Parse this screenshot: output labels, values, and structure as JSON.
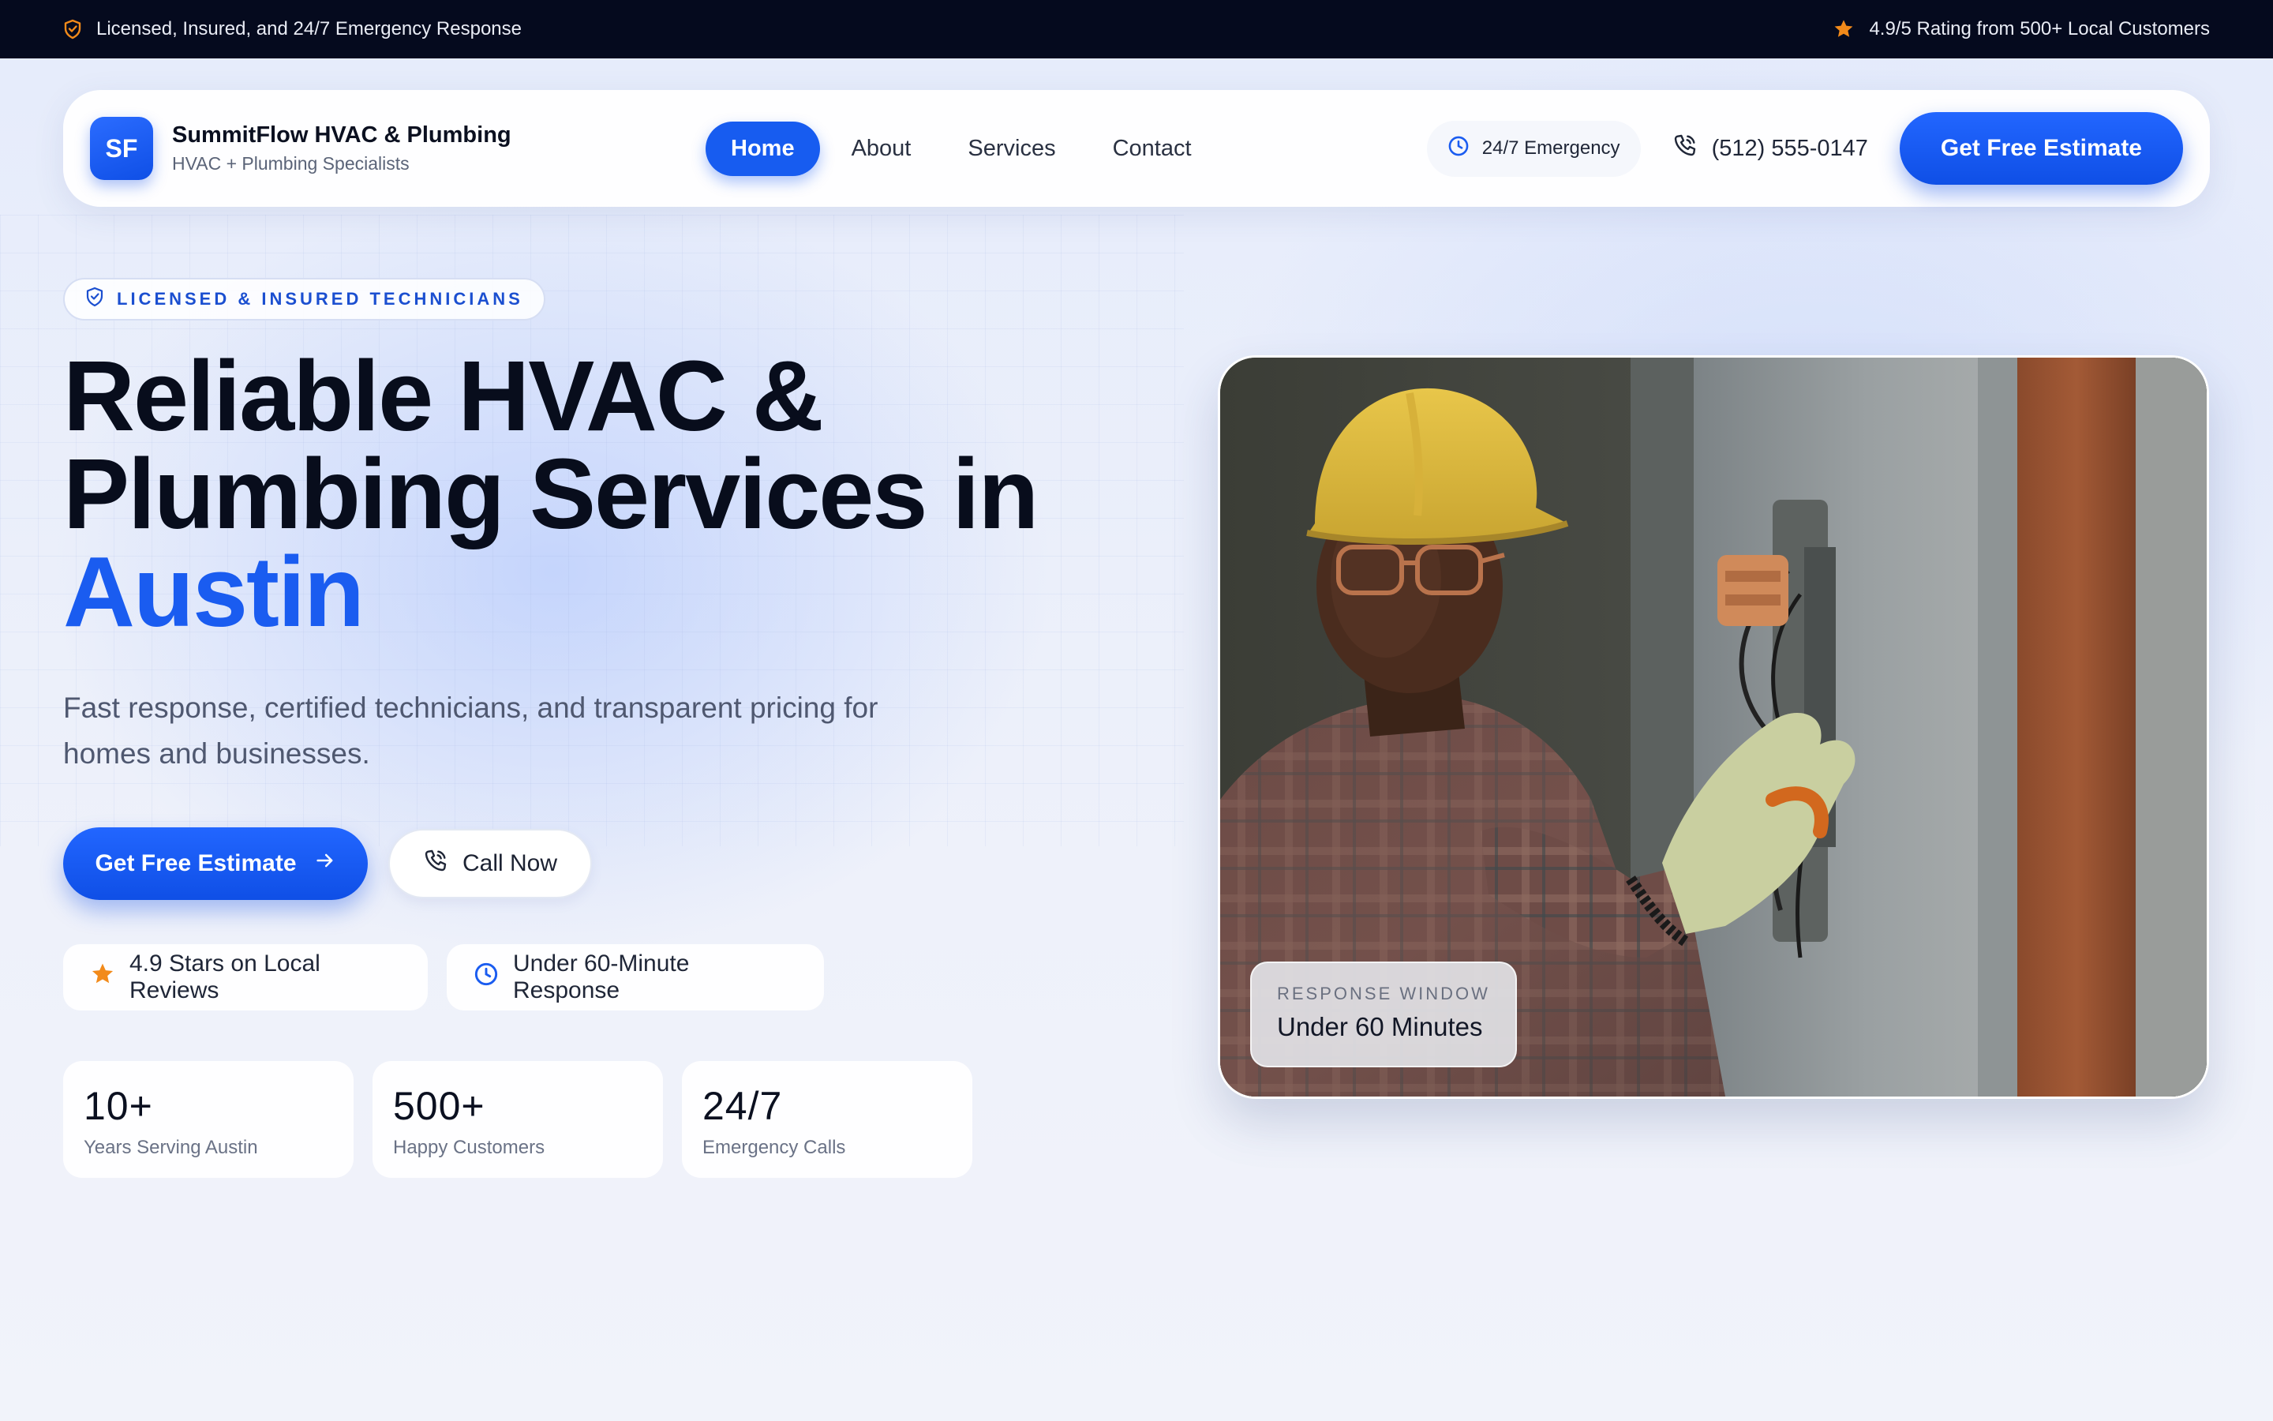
{
  "topbar": {
    "left_text": "Licensed, Insured, and 24/7 Emergency Response",
    "right_text": "4.9/5 Rating from 500+ Local Customers",
    "left_icon": "shield-check-icon",
    "right_icon": "star-icon",
    "accent_color": "#f28a1a"
  },
  "nav": {
    "logo_text": "SF",
    "brand_name": "SummitFlow HVAC & Plumbing",
    "brand_tagline": "HVAC + Plumbing Specialists",
    "links": [
      {
        "label": "Home",
        "active": true
      },
      {
        "label": "About",
        "active": false
      },
      {
        "label": "Services",
        "active": false
      },
      {
        "label": "Contact",
        "active": false
      }
    ],
    "emergency_label": "24/7 Emergency",
    "phone": "(512) 555-0147",
    "cta_label": "Get Free Estimate"
  },
  "hero": {
    "badge": "LICENSED & INSURED TECHNICIANS",
    "headline_line1": "Reliable HVAC &",
    "headline_line2": "Plumbing Services in",
    "headline_accent": "Austin",
    "subtext": "Fast response, certified technicians, and transparent pricing for homes and businesses.",
    "primary_button": "Get Free Estimate",
    "secondary_button": "Call Now",
    "chips": [
      {
        "icon": "star-icon",
        "label": "4.9 Stars on Local Reviews"
      },
      {
        "icon": "clock-icon",
        "label": "Under 60-Minute Response"
      }
    ],
    "stats": [
      {
        "value": "10+",
        "label": "Years Serving Austin"
      },
      {
        "value": "500+",
        "label": "Happy Customers"
      },
      {
        "value": "24/7",
        "label": "Emergency Calls"
      }
    ],
    "image_overlay": {
      "label": "RESPONSE WINDOW",
      "value": "Under 60 Minutes"
    }
  },
  "colors": {
    "primary": "#175cf0",
    "dark": "#050a1e",
    "accent_orange": "#f28a1a"
  }
}
